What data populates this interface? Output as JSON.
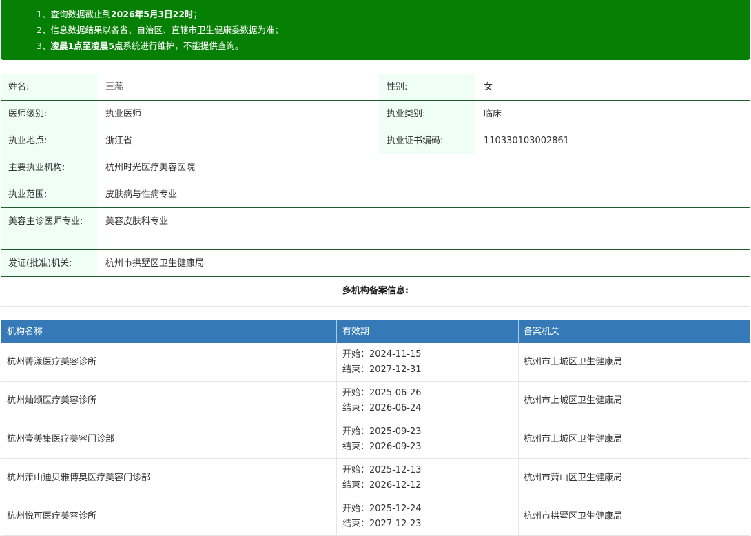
{
  "notice": {
    "l1_pre": "1、查询数据截止到",
    "l1_bold": "2026年5月3日22时",
    "l1_post": "；",
    "l2": "2、信息数据结果以各省、自治区、直辖市卫生健康委数据为准；",
    "l3_pre": "3、",
    "l3_bold": "凌晨1点至凌晨5点",
    "l3_post": "系统进行维护，不能提供查询。"
  },
  "info": {
    "name_label": "姓名:",
    "name": "王蕊",
    "gender_label": "性别:",
    "gender": "女",
    "level_label": "医师级别:",
    "level": "执业医师",
    "category_label": "执业类别:",
    "category": "临床",
    "place_label": "执业地点:",
    "place": "浙江省",
    "cert_label": "执业证书编码:",
    "cert": "110330103002861",
    "org_label": "主要执业机构:",
    "org": "杭州时光医疗美容医院",
    "scope_label": "执业范围:",
    "scope": "皮肤病与性病专业",
    "cosmetic_label": "美容主诊医师专业:",
    "cosmetic": "美容皮肤科专业",
    "issuer_label": "发证(批准)机关:",
    "issuer": "杭州市拱墅区卫生健康局"
  },
  "multi_title": "多机构备案信息:",
  "table": {
    "headers": [
      "机构名称",
      "有效期",
      "备案机关"
    ],
    "rows": [
      {
        "name": "杭州菁漾医疗美容诊所",
        "start": "开始：2024-11-15",
        "end": "结束：2027-12-31",
        "org": "杭州市上城区卫生健康局"
      },
      {
        "name": "杭州灿颂医疗美容诊所",
        "start": "开始：2025-06-26",
        "end": "结束：2026-06-24",
        "org": "杭州市上城区卫生健康局"
      },
      {
        "name": "杭州壹美集医疗美容门诊部",
        "start": "开始：2025-09-23",
        "end": "结束：2026-09-23",
        "org": "杭州市上城区卫生健康局"
      },
      {
        "name": "杭州萧山迪贝雅博奥医疗美容门诊部",
        "start": "开始：2025-12-13",
        "end": "结束：2026-12-12",
        "org": "杭州市萧山区卫生健康局"
      },
      {
        "name": "杭州悦可医疗美容诊所",
        "start": "开始：2025-12-24",
        "end": "结束：2027-12-23",
        "org": "杭州市拱墅区卫生健康局"
      }
    ]
  }
}
